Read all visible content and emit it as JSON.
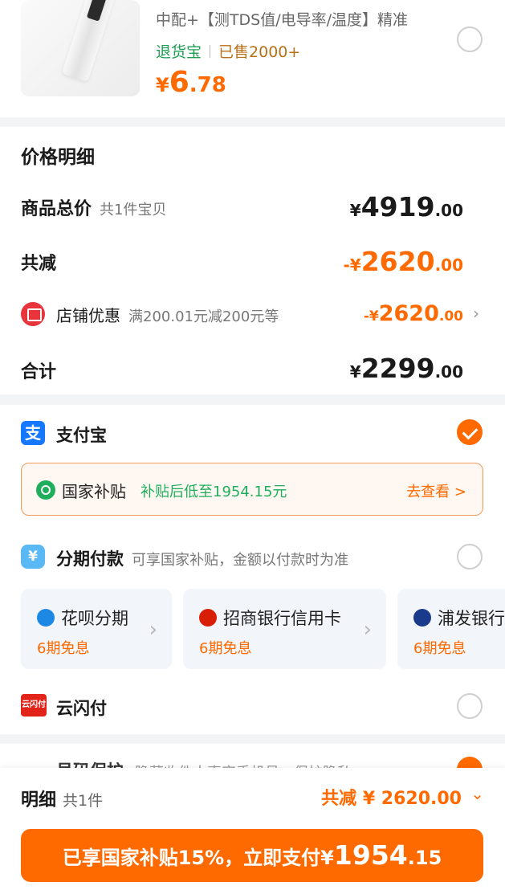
{
  "product": {
    "desc": "中配+【测TDS值/电导率/温度】精准",
    "tag_return": "退货宝",
    "tag_sold": "已售2000+",
    "price_currency": "¥",
    "price_int": "6",
    "price_dec": ".78"
  },
  "detail": {
    "title": "价格明细",
    "total_label": "商品总价",
    "total_sub": "共1件宝贝",
    "total_cur": "¥",
    "total_int": "4919",
    "total_dec": ".00",
    "reduce_label": "共减",
    "reduce_cur": "-¥",
    "reduce_int": "2620",
    "reduce_dec": ".00",
    "shop_label": "店铺优惠",
    "shop_sub": "满200.01元减200元等",
    "shop_cur": "-¥",
    "shop_int": "2620",
    "shop_dec": ".00",
    "sum_label": "合计",
    "sum_cur": "¥",
    "sum_int": "2299",
    "sum_dec": ".00"
  },
  "payment": {
    "alipay_icon": "支",
    "alipay_name": "支付宝",
    "subsidy_title": "国家补贴",
    "subsidy_text": "补贴后低至1954.15元",
    "subsidy_link": "去查看 >",
    "fenqi_name": "分期付款",
    "fenqi_sub": "可享国家补贴，金额以付款时为准",
    "plans": [
      {
        "name": "花呗分期",
        "term": "6期免息",
        "color": "#1e88e5"
      },
      {
        "name": "招商银行信用卡",
        "term": "6期免息",
        "color": "#d81e06"
      },
      {
        "name": "浦发银行",
        "term": "6期免息",
        "color": "#1a3a8c"
      }
    ],
    "yun_icon": "云闪付",
    "yun_name": "云闪付",
    "chevron": "›"
  },
  "peek": {
    "name": "号码保护",
    "sub": "隐藏收件人真实手机号，保护隐私"
  },
  "bottom": {
    "label": "明细",
    "sub": "共1件",
    "total": "共减 ¥ 2620.00",
    "chev": "⌄",
    "btn_text": "已享国家补贴15%，立即支付¥",
    "btn_int": "1954",
    "btn_dec": ".15"
  },
  "colors": {
    "accent": "#ff6a00",
    "green": "#1faf5c"
  }
}
